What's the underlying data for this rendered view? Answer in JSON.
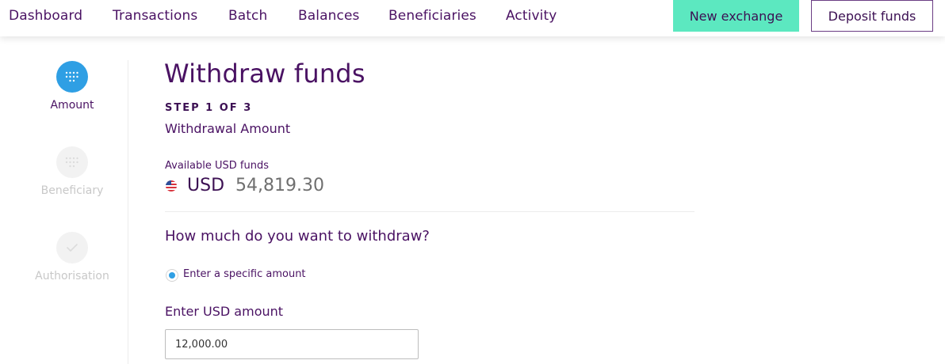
{
  "nav": {
    "items": [
      "Dashboard",
      "Transactions",
      "Batch",
      "Balances",
      "Beneficiaries",
      "Activity"
    ],
    "new_exchange_label": "New exchange",
    "deposit_funds_label": "Deposit funds"
  },
  "stepper": {
    "steps": [
      {
        "label": "Amount",
        "state": "active",
        "icon": "keypad-icon"
      },
      {
        "label": "Beneficiary",
        "state": "inactive",
        "icon": "keypad-icon"
      },
      {
        "label": "Authorisation",
        "state": "inactive",
        "icon": "check-icon"
      }
    ]
  },
  "page": {
    "title": "Withdraw funds",
    "step_count": "STEP 1 OF 3",
    "step_name": "Withdrawal Amount"
  },
  "balance": {
    "label": "Available USD funds",
    "flag_icon": "us-flag-icon",
    "currency": "USD",
    "amount": "54,819.30"
  },
  "form": {
    "question": "How much do you want to withdraw?",
    "radio_label": "Enter a specific amount",
    "radio_selected": true,
    "amount_label": "Enter USD amount",
    "amount_value": "12,000.00"
  },
  "colors": {
    "brand_purple": "#4a1263",
    "accent_green": "#5ce8c0",
    "active_blue": "#2f9fe4"
  }
}
